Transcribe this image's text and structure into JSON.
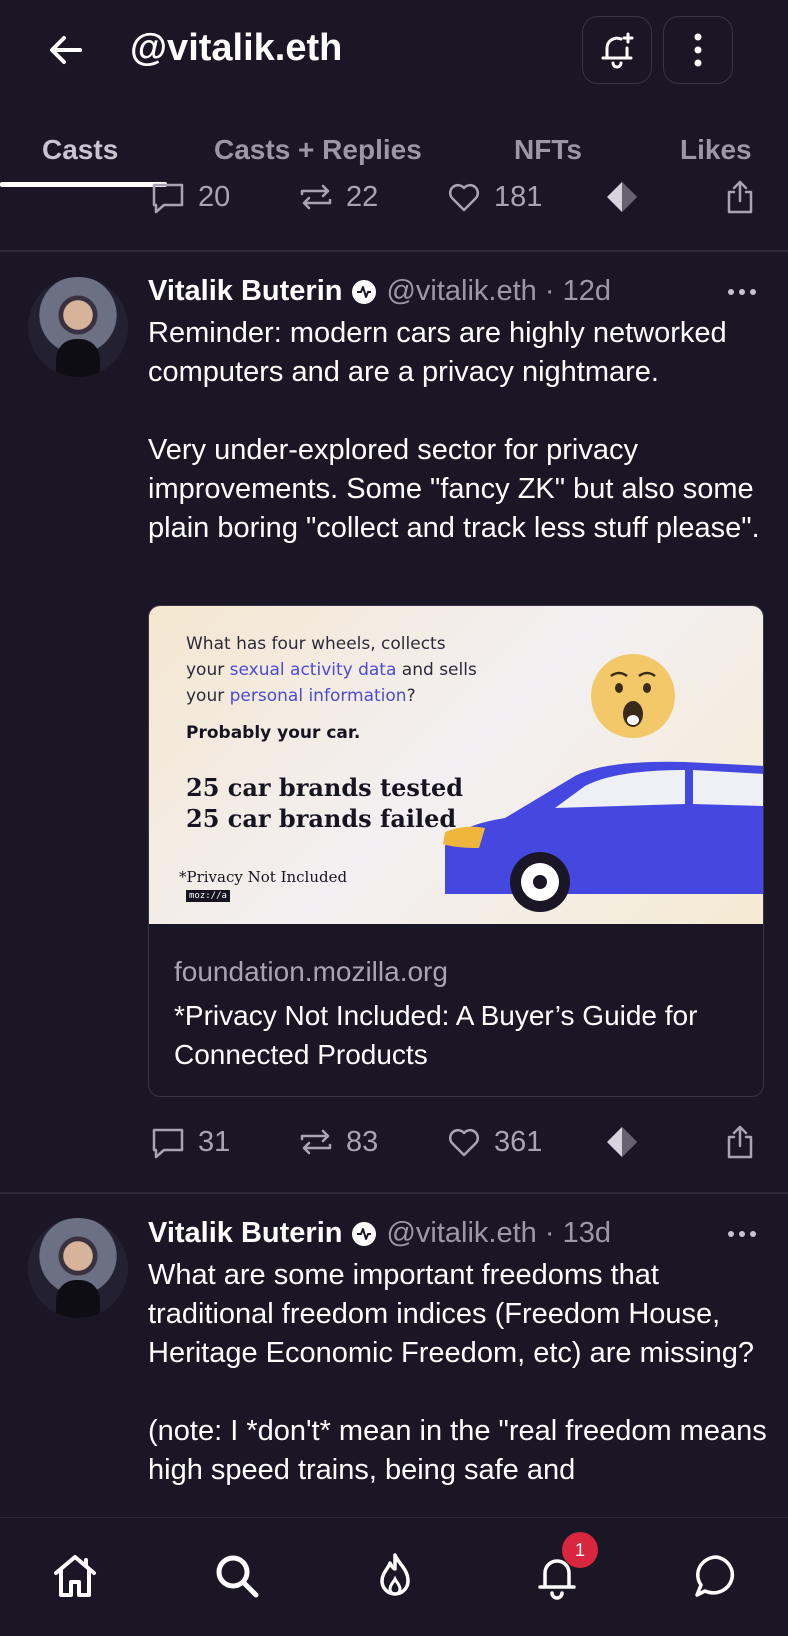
{
  "header": {
    "title": "@vitalik.eth",
    "back_icon": "arrow-left-icon",
    "notify_icon": "bell-plus-icon",
    "menu_icon": "vertical-dots-icon"
  },
  "tabs": [
    {
      "label": "Casts",
      "active": true
    },
    {
      "label": "Casts + Replies",
      "active": false
    },
    {
      "label": "NFTs",
      "active": false
    },
    {
      "label": "Likes",
      "active": false
    }
  ],
  "prev_post_actions": {
    "replies": "20",
    "recasts": "22",
    "likes": "181"
  },
  "posts": [
    {
      "author": "Vitalik Buterin",
      "handle": "@vitalik.eth",
      "age": "12d",
      "text": "Reminder: modern cars are highly networked computers and are a privacy nightmare.\n\nVery under-explored sector for privacy improvements. Some \"fancy ZK\" but also some plain boring \"collect and track less stuff please\".",
      "embed": {
        "image_lines": {
          "line1": "What has four wheels, collects",
          "line2_pre": "your ",
          "line2_hl": "sexual activity data",
          "line2_post": " and sells",
          "line3_pre": "your ",
          "line3_hl": "personal information",
          "line3_post": "?",
          "bold": "Probably your car.",
          "big1": "25 car brands tested",
          "big2": "25 car brands failed",
          "small": "*Privacy Not Included",
          "brand": "moz://a"
        },
        "domain": "foundation.mozilla.org",
        "title": "*Privacy Not Included: A Buyer’s Guide for Connected Products"
      },
      "replies": "31",
      "recasts": "83",
      "likes": "361"
    },
    {
      "author": "Vitalik Buterin",
      "handle": "@vitalik.eth",
      "age": "13d",
      "text": "What are some important freedoms that traditional freedom indices (Freedom House, Heritage Economic Freedom, etc) are missing?\n\n(note: I *don't* mean in the \"real freedom means high speed trains, being safe and"
    }
  ],
  "bottom_nav": {
    "items": [
      "home-icon",
      "search-icon",
      "flame-icon",
      "bell-icon",
      "chat-icon"
    ],
    "notification_count": "1"
  },
  "colors": {
    "background": "#1b1625",
    "muted_text": "#a9a4b3",
    "badge_red": "#d7263d",
    "car_blue": "#4548e0"
  }
}
